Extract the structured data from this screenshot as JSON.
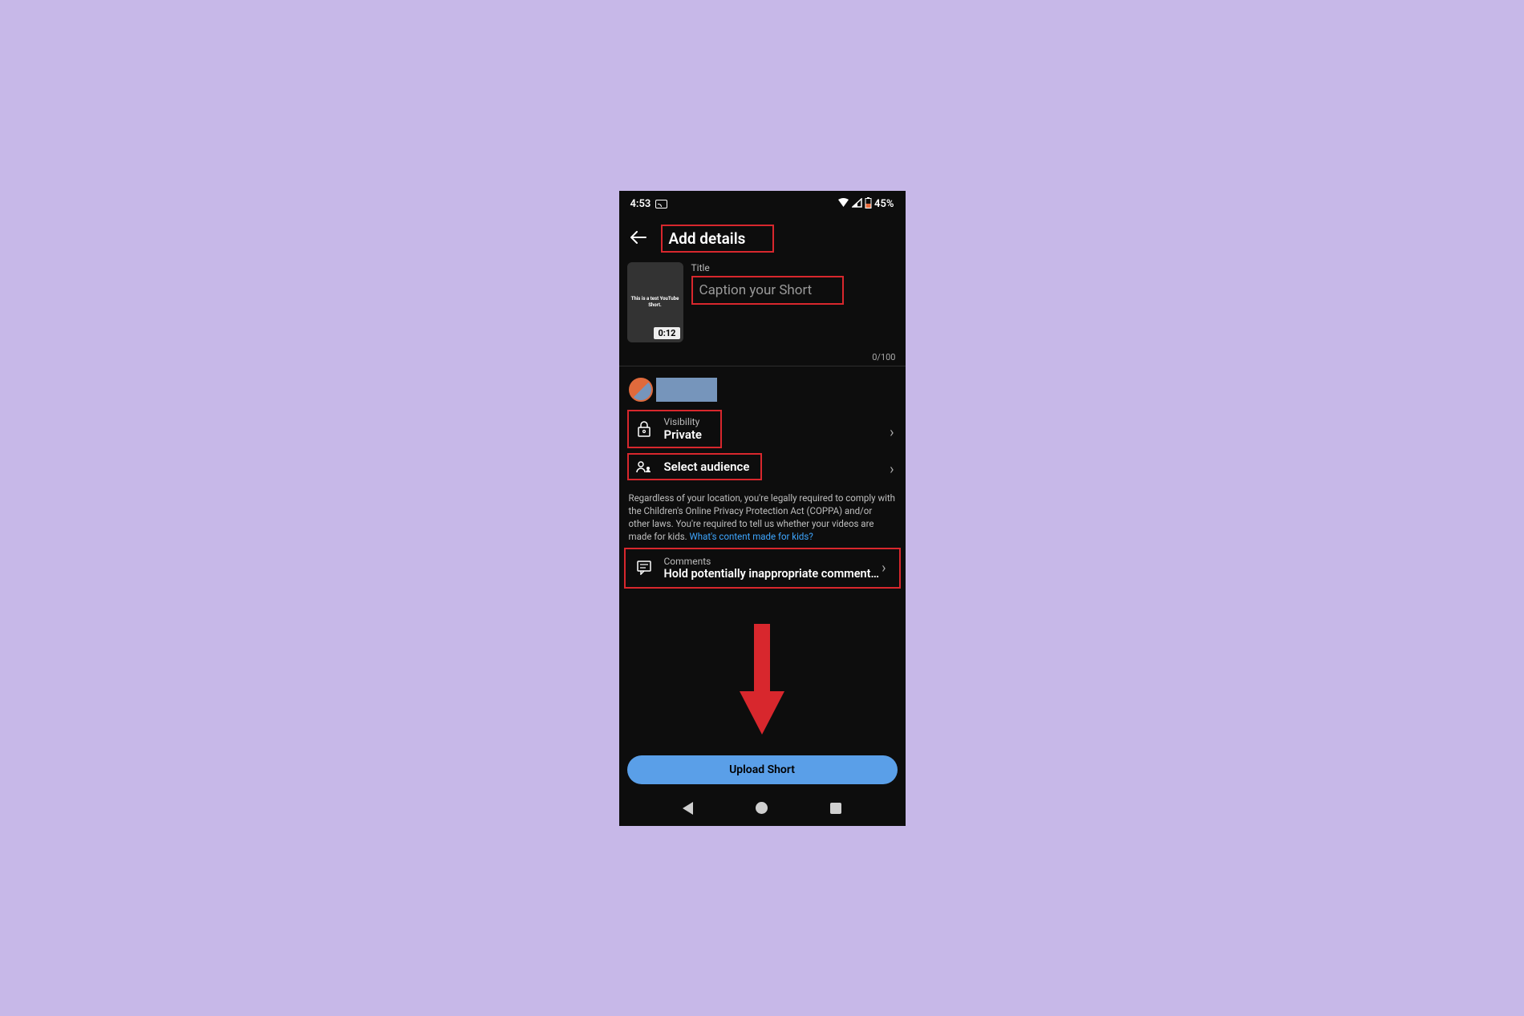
{
  "status": {
    "time": "4:53",
    "battery": "45%"
  },
  "header": {
    "title": "Add details"
  },
  "thumbnail": {
    "preview_text": "This is a test YouTube Short.",
    "duration": "0:12"
  },
  "title_field": {
    "label": "Title",
    "placeholder": "Caption your Short",
    "counter": "0/100"
  },
  "visibility": {
    "label": "Visibility",
    "value": "Private"
  },
  "audience": {
    "label": "Select audience"
  },
  "coppa": {
    "text": "Regardless of your location, you're legally required to comply with the Children's Online Privacy Protection Act (COPPA) and/or other laws. You're required to tell us whether your videos are made for kids.",
    "link": "What's content made for kids?"
  },
  "comments": {
    "label": "Comments",
    "value": "Hold potentially inappropriate comment…"
  },
  "upload_button": "Upload Short"
}
